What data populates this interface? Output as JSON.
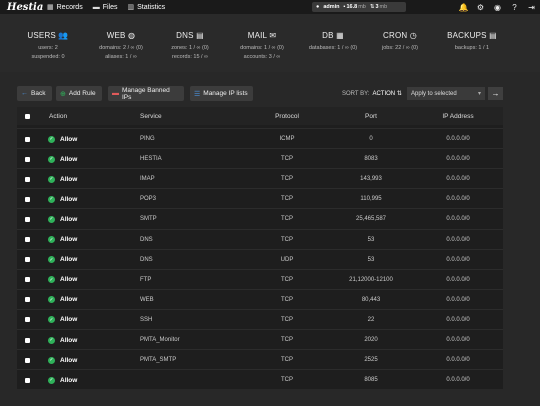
{
  "nav": {
    "logo": "Hestia",
    "links": [
      {
        "label": "Records",
        "icon": "records-icon"
      },
      {
        "label": "Files",
        "icon": "folder-icon"
      },
      {
        "label": "Statistics",
        "icon": "chart-icon"
      }
    ],
    "user": {
      "name": "admin",
      "disk": "16.8",
      "disk_unit": "mb",
      "count": "3",
      "count_unit": "mb"
    }
  },
  "stats": [
    {
      "title": "USERS",
      "icon": "users-icon",
      "lines": [
        "users: 2",
        "suspended: 0"
      ]
    },
    {
      "title": "WEB",
      "icon": "globe-icon",
      "lines": [
        "domains: 2 / ∞ (0)",
        "aliases: 1 / ∞"
      ]
    },
    {
      "title": "DNS",
      "icon": "dns-icon",
      "lines": [
        "zones: 1 / ∞ (0)",
        "records: 15 / ∞"
      ]
    },
    {
      "title": "MAIL",
      "icon": "mail-icon",
      "lines": [
        "domains: 1 / ∞ (0)",
        "accounts: 3 / ∞"
      ]
    },
    {
      "title": "DB",
      "icon": "database-icon",
      "lines": [
        "databases: 1 / ∞ (0)"
      ]
    },
    {
      "title": "CRON",
      "icon": "clock-icon",
      "lines": [
        "jobs: 22 / ∞ (0)"
      ]
    },
    {
      "title": "BACKUPS",
      "icon": "backup-icon",
      "lines": [
        "backups: 1 / 1"
      ]
    }
  ],
  "toolbar": {
    "back": "Back",
    "add_rule": "Add Rule",
    "manage_banned": "Manage Banned IPs",
    "manage_ip_lists": "Manage IP lists",
    "sort_label": "SORT BY:",
    "sort_value": "ACTION",
    "apply_selected": "Apply to selected"
  },
  "table": {
    "headers": {
      "action": "Action",
      "service": "Service",
      "protocol": "Protocol",
      "port": "Port",
      "ip": "IP Address"
    },
    "rows": [
      {
        "action": "Allow",
        "service": "PING",
        "protocol": "ICMP",
        "port": "0",
        "ip": "0.0.0.0/0"
      },
      {
        "action": "Allow",
        "service": "HESTIA",
        "protocol": "TCP",
        "port": "8083",
        "ip": "0.0.0.0/0"
      },
      {
        "action": "Allow",
        "service": "IMAP",
        "protocol": "TCP",
        "port": "143,993",
        "ip": "0.0.0.0/0"
      },
      {
        "action": "Allow",
        "service": "POP3",
        "protocol": "TCP",
        "port": "110,995",
        "ip": "0.0.0.0/0"
      },
      {
        "action": "Allow",
        "service": "SMTP",
        "protocol": "TCP",
        "port": "25,465,587",
        "ip": "0.0.0.0/0"
      },
      {
        "action": "Allow",
        "service": "DNS",
        "protocol": "TCP",
        "port": "53",
        "ip": "0.0.0.0/0"
      },
      {
        "action": "Allow",
        "service": "DNS",
        "protocol": "UDP",
        "port": "53",
        "ip": "0.0.0.0/0"
      },
      {
        "action": "Allow",
        "service": "FTP",
        "protocol": "TCP",
        "port": "21,12000-12100",
        "ip": "0.0.0.0/0"
      },
      {
        "action": "Allow",
        "service": "WEB",
        "protocol": "TCP",
        "port": "80,443",
        "ip": "0.0.0.0/0"
      },
      {
        "action": "Allow",
        "service": "SSH",
        "protocol": "TCP",
        "port": "22",
        "ip": "0.0.0.0/0"
      },
      {
        "action": "Allow",
        "service": "PMTA_Monitor",
        "protocol": "TCP",
        "port": "2020",
        "ip": "0.0.0.0/0"
      },
      {
        "action": "Allow",
        "service": "PMTA_SMTP",
        "protocol": "TCP",
        "port": "2525",
        "ip": "0.0.0.0/0"
      },
      {
        "action": "Allow",
        "service": "",
        "protocol": "TCP",
        "port": "8085",
        "ip": "0.0.0.0/0"
      }
    ]
  }
}
